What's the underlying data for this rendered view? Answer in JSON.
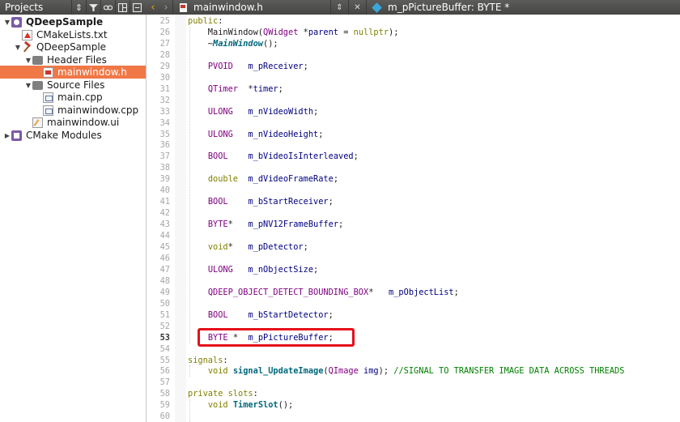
{
  "toolbar": {
    "projects_title": "Projects",
    "open_file": "mainwindow.h",
    "current_symbol": "m_pPictureBuffer: BYTE *"
  },
  "tree": [
    {
      "label": "QDeepSample",
      "level": 0,
      "icon": "project-icon",
      "expanded": true,
      "bold": true
    },
    {
      "label": "CMakeLists.txt",
      "level": 1,
      "icon": "cmake-file-icon"
    },
    {
      "label": "QDeepSample",
      "level": 1,
      "icon": "hammer-icon",
      "expanded": true
    },
    {
      "label": "Header Files",
      "level": 2,
      "icon": "folder-icon",
      "expanded": true
    },
    {
      "label": "mainwindow.h",
      "level": 3,
      "icon": "header-file-icon",
      "selected": true
    },
    {
      "label": "Source Files",
      "level": 2,
      "icon": "folder-icon",
      "expanded": true
    },
    {
      "label": "main.cpp",
      "level": 3,
      "icon": "cpp-file-icon"
    },
    {
      "label": "mainwindow.cpp",
      "level": 3,
      "icon": "cpp-file-icon"
    },
    {
      "label": "mainwindow.ui",
      "level": 2,
      "icon": "ui-file-icon"
    },
    {
      "label": "CMake Modules",
      "level": 0,
      "icon": "cmake-modules-icon",
      "expanded": false
    }
  ],
  "code": [
    {
      "n": "25",
      "t": "public:"
    },
    {
      "n": "26",
      "t": "    MainWindow(QWidget *parent = nullptr);"
    },
    {
      "n": "27",
      "t": "    ~MainWindow();"
    },
    {
      "n": "28",
      "t": ""
    },
    {
      "n": "29",
      "t": "    PVOID   m_pReceiver;"
    },
    {
      "n": "30",
      "t": ""
    },
    {
      "n": "31",
      "t": "    QTimer  *timer;"
    },
    {
      "n": "32",
      "t": ""
    },
    {
      "n": "33",
      "t": "    ULONG   m_nVideoWidth;"
    },
    {
      "n": "34",
      "t": ""
    },
    {
      "n": "35",
      "t": "    ULONG   m_nVideoHeight;"
    },
    {
      "n": "36",
      "t": ""
    },
    {
      "n": "37",
      "t": "    BOOL    m_bVideoIsInterleaved;"
    },
    {
      "n": "38",
      "t": ""
    },
    {
      "n": "39",
      "t": "    double  m_dVideoFrameRate;"
    },
    {
      "n": "40",
      "t": ""
    },
    {
      "n": "41",
      "t": "    BOOL    m_bStartReceiver;"
    },
    {
      "n": "42",
      "t": ""
    },
    {
      "n": "43",
      "t": "    BYTE*   m_pNV12FrameBuffer;"
    },
    {
      "n": "44",
      "t": ""
    },
    {
      "n": "45",
      "t": "    void*   m_pDetector;"
    },
    {
      "n": "46",
      "t": ""
    },
    {
      "n": "47",
      "t": "    ULONG   m_nObjectSize;"
    },
    {
      "n": "48",
      "t": ""
    },
    {
      "n": "49",
      "t": "    QDEEP_OBJECT_DETECT_BOUNDING_BOX*   m_pObjectList;"
    },
    {
      "n": "50",
      "t": ""
    },
    {
      "n": "51",
      "t": "    BOOL    m_bStartDetector;"
    },
    {
      "n": "52",
      "t": ""
    },
    {
      "n": "53",
      "t": "    BYTE *  m_pPictureBuffer;",
      "current": true
    },
    {
      "n": "54",
      "t": ""
    },
    {
      "n": "55",
      "t": "signals:"
    },
    {
      "n": "56",
      "t": "    void signal_UpdateImage(QImage img); //SIGNAL TO TRANSFER IMAGE DATA ACROSS THREADS"
    },
    {
      "n": "57",
      "t": ""
    },
    {
      "n": "58",
      "t": "private slots:"
    },
    {
      "n": "59",
      "t": "    void TimerSlot();"
    },
    {
      "n": "60",
      "t": ""
    }
  ],
  "colors": {
    "selection": "#f07746",
    "highlight_box": "#e5101b",
    "toolbar": "#4f4f4d"
  }
}
